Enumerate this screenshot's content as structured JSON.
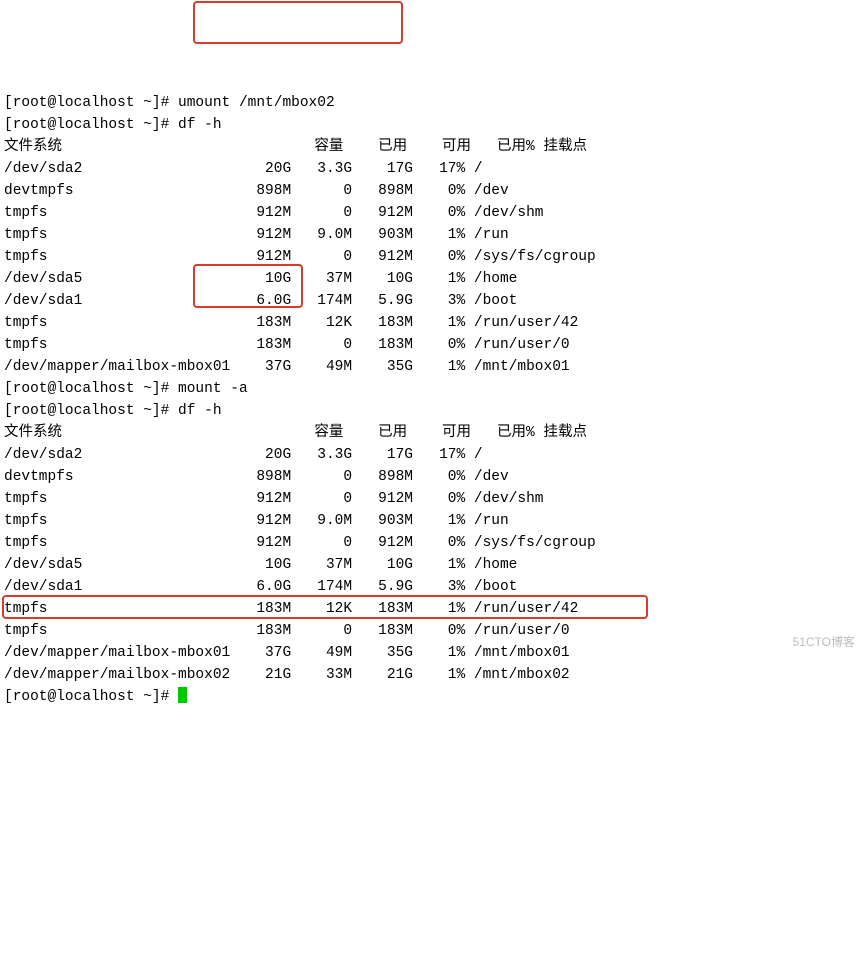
{
  "prompt": "[root@localhost ~]#",
  "cmds": {
    "umount": "umount /mnt/mbox02",
    "dfh1": "df -h",
    "mounta": "mount -a",
    "dfh2": "df -h"
  },
  "headers": {
    "fs": "文件系统",
    "size": "容量",
    "used": "已用",
    "avail": "可用",
    "usep": "已用%",
    "mp": "挂载点"
  },
  "df1": [
    {
      "fs": "/dev/sda2",
      "size": "20G",
      "used": "3.3G",
      "avail": "17G",
      "usep": "17%",
      "mp": "/"
    },
    {
      "fs": "devtmpfs",
      "size": "898M",
      "used": "0",
      "avail": "898M",
      "usep": "0%",
      "mp": "/dev"
    },
    {
      "fs": "tmpfs",
      "size": "912M",
      "used": "0",
      "avail": "912M",
      "usep": "0%",
      "mp": "/dev/shm"
    },
    {
      "fs": "tmpfs",
      "size": "912M",
      "used": "9.0M",
      "avail": "903M",
      "usep": "1%",
      "mp": "/run"
    },
    {
      "fs": "tmpfs",
      "size": "912M",
      "used": "0",
      "avail": "912M",
      "usep": "0%",
      "mp": "/sys/fs/cgroup"
    },
    {
      "fs": "/dev/sda5",
      "size": "10G",
      "used": "37M",
      "avail": "10G",
      "usep": "1%",
      "mp": "/home"
    },
    {
      "fs": "/dev/sda1",
      "size": "6.0G",
      "used": "174M",
      "avail": "5.9G",
      "usep": "3%",
      "mp": "/boot"
    },
    {
      "fs": "tmpfs",
      "size": "183M",
      "used": "12K",
      "avail": "183M",
      "usep": "1%",
      "mp": "/run/user/42"
    },
    {
      "fs": "tmpfs",
      "size": "183M",
      "used": "0",
      "avail": "183M",
      "usep": "0%",
      "mp": "/run/user/0"
    },
    {
      "fs": "/dev/mapper/mailbox-mbox01",
      "size": "37G",
      "used": "49M",
      "avail": "35G",
      "usep": "1%",
      "mp": "/mnt/mbox01"
    }
  ],
  "df2": [
    {
      "fs": "/dev/sda2",
      "size": "20G",
      "used": "3.3G",
      "avail": "17G",
      "usep": "17%",
      "mp": "/"
    },
    {
      "fs": "devtmpfs",
      "size": "898M",
      "used": "0",
      "avail": "898M",
      "usep": "0%",
      "mp": "/dev"
    },
    {
      "fs": "tmpfs",
      "size": "912M",
      "used": "0",
      "avail": "912M",
      "usep": "0%",
      "mp": "/dev/shm"
    },
    {
      "fs": "tmpfs",
      "size": "912M",
      "used": "9.0M",
      "avail": "903M",
      "usep": "1%",
      "mp": "/run"
    },
    {
      "fs": "tmpfs",
      "size": "912M",
      "used": "0",
      "avail": "912M",
      "usep": "0%",
      "mp": "/sys/fs/cgroup"
    },
    {
      "fs": "/dev/sda5",
      "size": "10G",
      "used": "37M",
      "avail": "10G",
      "usep": "1%",
      "mp": "/home"
    },
    {
      "fs": "/dev/sda1",
      "size": "6.0G",
      "used": "174M",
      "avail": "5.9G",
      "usep": "3%",
      "mp": "/boot"
    },
    {
      "fs": "tmpfs",
      "size": "183M",
      "used": "12K",
      "avail": "183M",
      "usep": "1%",
      "mp": "/run/user/42"
    },
    {
      "fs": "tmpfs",
      "size": "183M",
      "used": "0",
      "avail": "183M",
      "usep": "0%",
      "mp": "/run/user/0"
    },
    {
      "fs": "/dev/mapper/mailbox-mbox01",
      "size": "37G",
      "used": "49M",
      "avail": "35G",
      "usep": "1%",
      "mp": "/mnt/mbox01"
    },
    {
      "fs": "/dev/mapper/mailbox-mbox02",
      "size": "21G",
      "used": "33M",
      "avail": "21G",
      "usep": "1%",
      "mp": "/mnt/mbox02"
    }
  ],
  "watermark": "51CTO博客"
}
